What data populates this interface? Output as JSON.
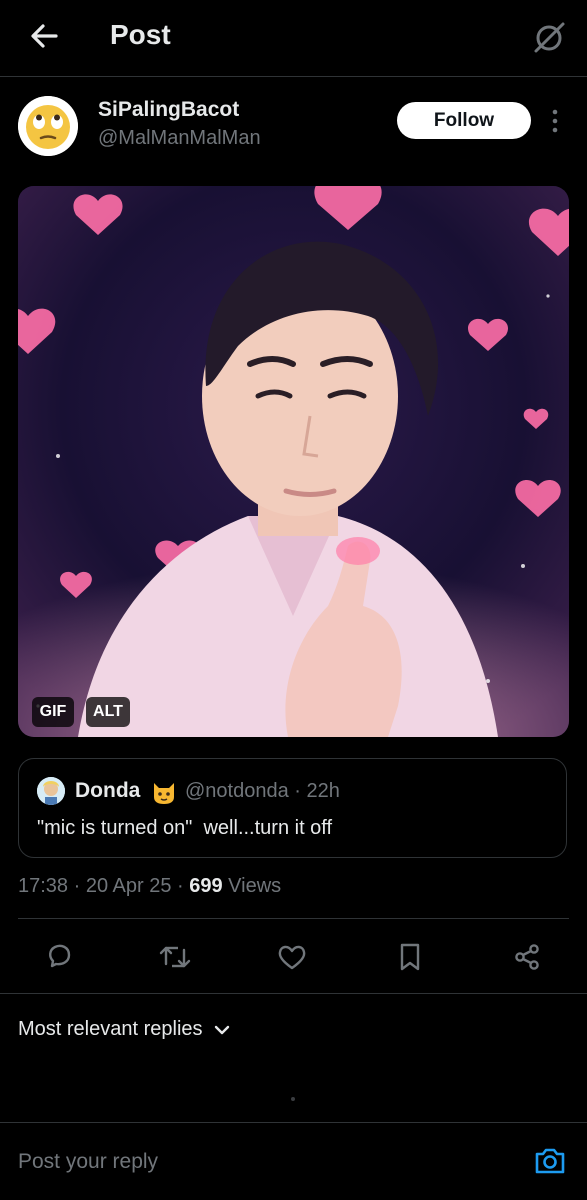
{
  "header": {
    "title": "Post"
  },
  "author": {
    "name": "SiPalingBacot",
    "handle": "@MalManMalMan",
    "follow_label": "Follow"
  },
  "media": {
    "badges": [
      "GIF",
      "ALT"
    ]
  },
  "quote": {
    "name": "Donda",
    "handle_time": "@notdonda · 22h",
    "text": "\"mic is turned on\"  well...turn it off"
  },
  "meta": {
    "time_date": "17:38 · 20 Apr 25 · ",
    "views_count": "699",
    "views_label": " Views"
  },
  "actions": [
    "reply-icon",
    "repost-icon",
    "like-icon",
    "bookmark-icon",
    "share-icon"
  ],
  "replies": {
    "sort_label": "Most relevant replies"
  },
  "composer": {
    "placeholder": "Post your reply"
  },
  "colors": {
    "background": "#000000",
    "text": "#e7e9ea",
    "muted": "#71767b",
    "border": "#2f3336",
    "accent": "#1d9bf0"
  }
}
